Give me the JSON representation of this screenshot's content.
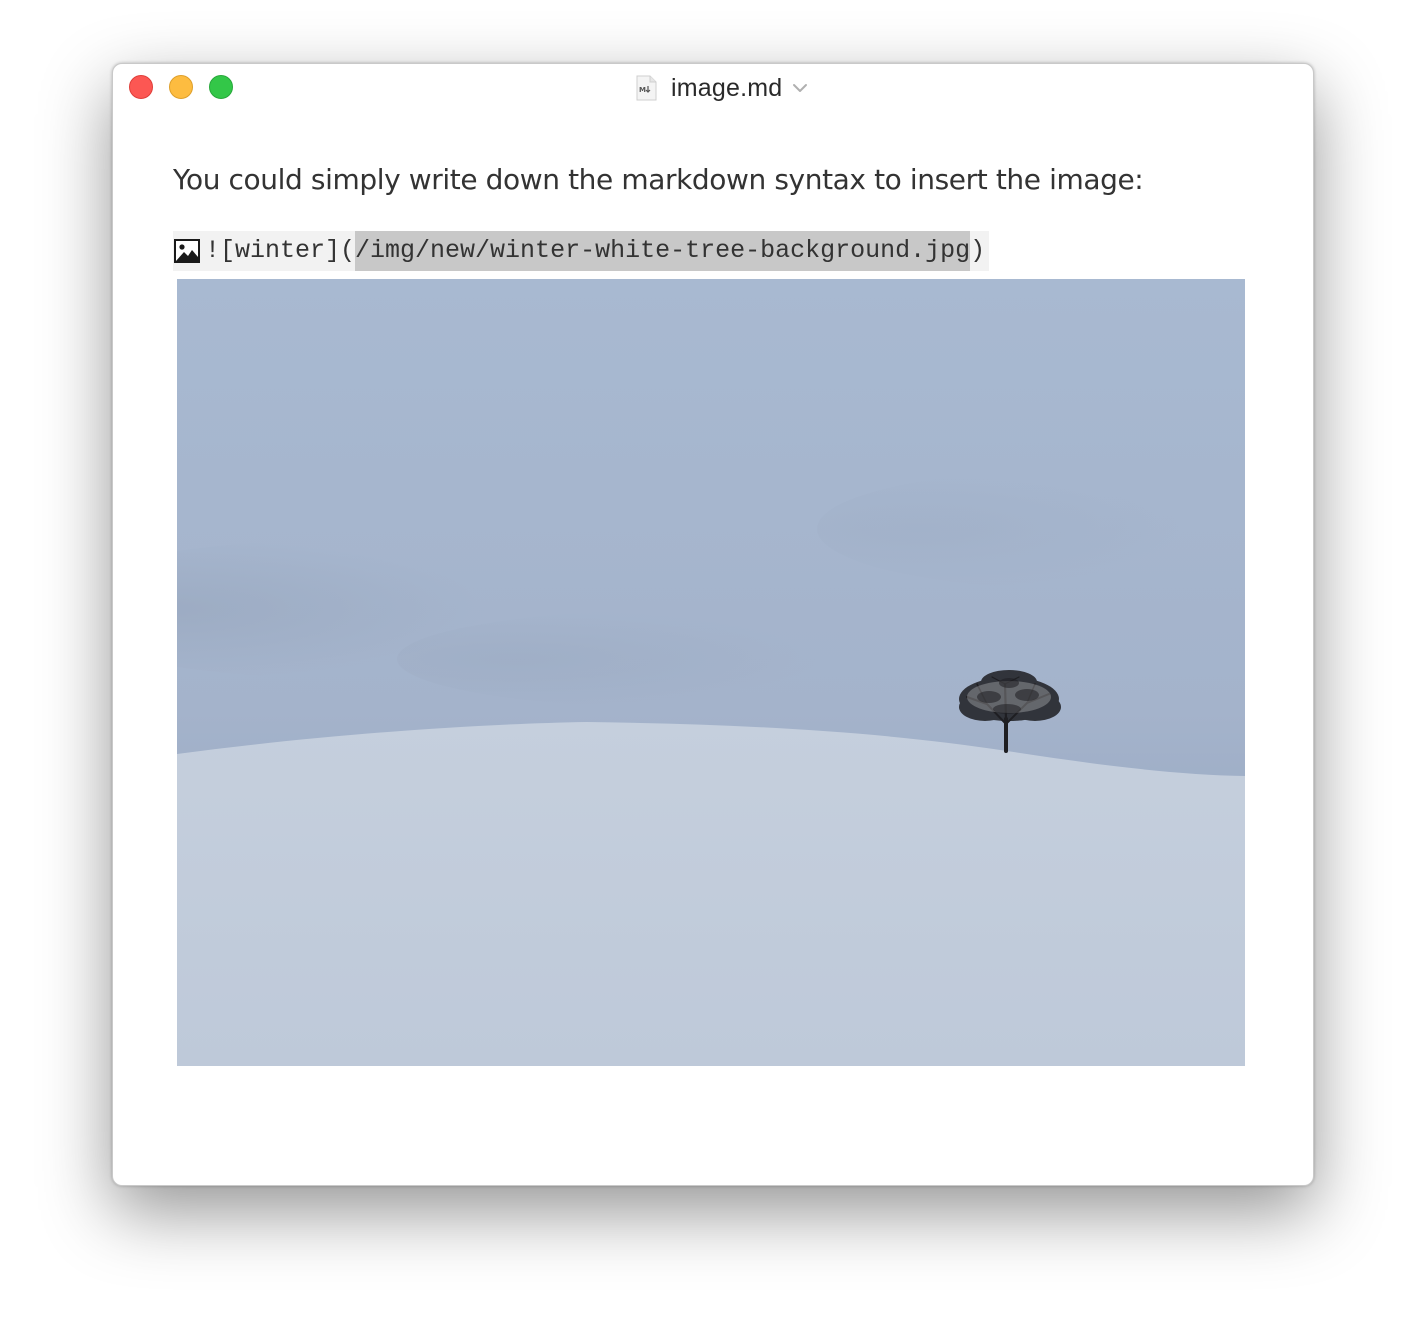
{
  "window": {
    "title": "image.md"
  },
  "editor": {
    "paragraph": "You could simply write down the markdown syntax to insert the image:",
    "markdown": {
      "prefix": "![winter](",
      "url": "/img/new/winter-white-tree-background.jpg",
      "suffix": ")"
    }
  },
  "image": {
    "alt": "winter",
    "subject": "snowy hill with a single bare tree under an overcast sky"
  },
  "colors": {
    "close": "#fc5753",
    "minimize": "#fdbc40",
    "zoom": "#33c748",
    "sky": "#a6b6cd",
    "snow": "#c2ccdb",
    "url_highlight": "#c8c8c8"
  },
  "icons": {
    "file": "markdown-file-icon",
    "dropdown": "chevron-down-icon",
    "inline_image": "image-icon"
  }
}
